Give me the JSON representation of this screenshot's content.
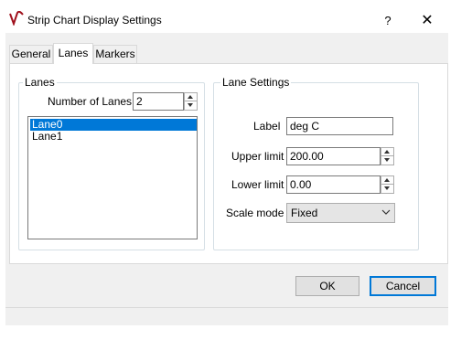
{
  "window": {
    "title": "Strip Chart Display Settings",
    "help": "?",
    "close": "✕"
  },
  "tabs": [
    {
      "label": "General"
    },
    {
      "label": "Lanes"
    },
    {
      "label": "Markers"
    }
  ],
  "lanes_group": {
    "title": "Lanes",
    "num_lanes_label": "Number of Lanes",
    "num_lanes_value": "2",
    "items": [
      {
        "label": "Lane0",
        "selected": true
      },
      {
        "label": "Lane1",
        "selected": false
      }
    ]
  },
  "lane_settings": {
    "title": "Lane Settings",
    "label_label": "Label",
    "label_value": "deg C",
    "upper_label": "Upper limit",
    "upper_value": "200.00",
    "lower_label": "Lower limit",
    "lower_value": "0.00",
    "scale_label": "Scale mode",
    "scale_value": "Fixed"
  },
  "buttons": {
    "ok": "OK",
    "cancel": "Cancel"
  },
  "colors": {
    "accent": "#0078d7",
    "icon": "#a0111d"
  }
}
